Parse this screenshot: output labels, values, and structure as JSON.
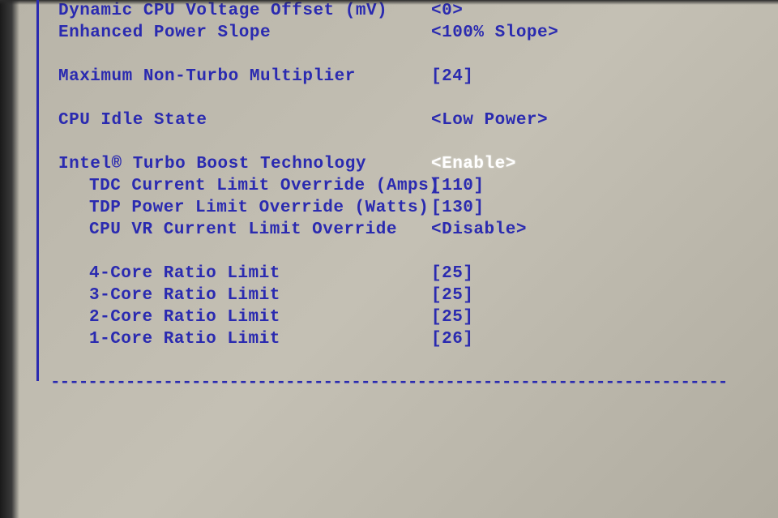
{
  "settings": {
    "dynamic_cpu_voltage_offset": {
      "label": "Dynamic CPU Voltage Offset (mV)",
      "value": "<0>"
    },
    "enhanced_power_slope": {
      "label": "Enhanced Power Slope",
      "value": "<100% Slope>"
    },
    "max_non_turbo_multiplier": {
      "label": "Maximum Non-Turbo Multiplier",
      "value": "[24]"
    },
    "cpu_idle_state": {
      "label": "CPU Idle State",
      "value": "<Low Power>"
    },
    "intel_turbo_boost": {
      "label": "Intel® Turbo Boost Technology",
      "value": "<Enable>",
      "selected": true
    },
    "tdc_current_limit": {
      "label": "TDC Current Limit Override (Amps)",
      "value": "[110]"
    },
    "tdp_power_limit": {
      "label": "TDP Power Limit Override (Watts)",
      "value": "[130]"
    },
    "cpu_vr_current_limit": {
      "label": "CPU VR Current Limit Override",
      "value": "<Disable>"
    },
    "four_core_ratio": {
      "label": "4-Core Ratio Limit",
      "value": "[25]"
    },
    "three_core_ratio": {
      "label": "3-Core Ratio Limit",
      "value": "[25]"
    },
    "two_core_ratio": {
      "label": "2-Core Ratio Limit",
      "value": "[25]"
    },
    "one_core_ratio": {
      "label": "1-Core Ratio Limit",
      "value": "[26]"
    }
  },
  "divider": "------------------------------------------------------------------------"
}
